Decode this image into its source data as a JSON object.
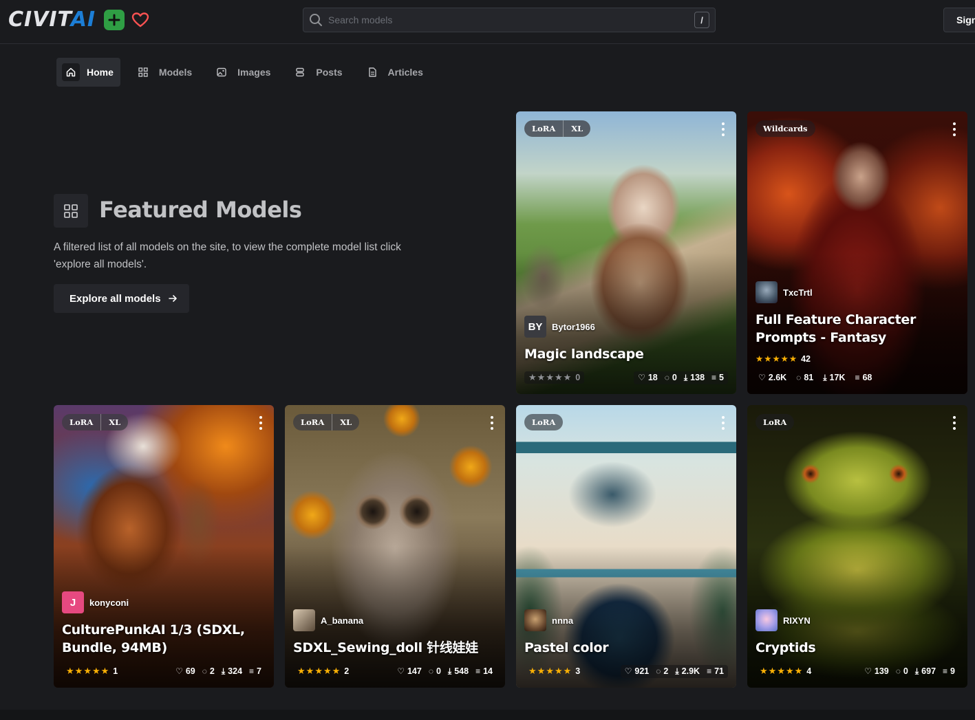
{
  "header": {
    "logo_civ": "CIVIT",
    "logo_ai": "AI",
    "search_placeholder": "Search models",
    "search_shortcut": "/",
    "signin_label": "Sign"
  },
  "nav": [
    {
      "label": "Home",
      "icon": "home-icon",
      "active": true
    },
    {
      "label": "Models",
      "icon": "grid-icon"
    },
    {
      "label": "Images",
      "icon": "image-icon"
    },
    {
      "label": "Posts",
      "icon": "posts-icon"
    },
    {
      "label": "Articles",
      "icon": "article-icon"
    }
  ],
  "featured": {
    "title": "Featured Models",
    "description": "A filtered list of all models on the site, to view the complete model list click 'explore all models'.",
    "explore_label": "Explore all models"
  },
  "cards": [
    {
      "badges": [
        "LoRA",
        "XL"
      ],
      "author": "Bytor1966",
      "avatar": "BY",
      "title": "Magic landscape",
      "rating": 0,
      "rating_count": "0",
      "rated": false,
      "likes": "18",
      "comments": "0",
      "downloads": "138",
      "versions": "5"
    },
    {
      "badges": [
        "Wildcards"
      ],
      "author": "TxcTrtl",
      "avatar": "",
      "title": "Full Feature Character Prompts - Fantasy",
      "rating": 5,
      "rating_count": "42",
      "rated": true,
      "likes": "2.6K",
      "comments": "81",
      "downloads": "17K",
      "versions": "68"
    },
    {
      "badges": [
        "LoRA",
        "XL"
      ],
      "author": "konyconi",
      "avatar": "J",
      "title": "CulturePunkAI 1/3 (SDXL, Bundle, 94MB)",
      "rating": 5,
      "rating_count": "1",
      "rated": true,
      "likes": "69",
      "comments": "2",
      "downloads": "324",
      "versions": "7"
    },
    {
      "badges": [
        "LoRA",
        "XL"
      ],
      "author": "A_banana",
      "avatar": "",
      "title": "SDXL_Sewing_doll 针线娃娃",
      "rating": 5,
      "rating_count": "2",
      "rated": true,
      "likes": "147",
      "comments": "0",
      "downloads": "548",
      "versions": "14"
    },
    {
      "badges": [
        "LoRA"
      ],
      "author": "nnna",
      "avatar": "",
      "title": "Pastel color",
      "rating": 5,
      "rating_count": "3",
      "rated": true,
      "likes": "921",
      "comments": "2",
      "downloads": "2.9K",
      "versions": "71"
    },
    {
      "badges": [
        "LoRA"
      ],
      "author": "RIXYN",
      "avatar": "",
      "title": "Cryptids",
      "rating": 5,
      "rating_count": "4",
      "rated": true,
      "likes": "139",
      "comments": "0",
      "downloads": "697",
      "versions": "9"
    }
  ],
  "colors": {
    "background": "#1a1b1e",
    "surface": "#25262b",
    "accent_blue": "#1c7ed6",
    "accent_green": "#2f9e44",
    "heart_red": "#fa5252",
    "star_yellow": "#fab005"
  }
}
